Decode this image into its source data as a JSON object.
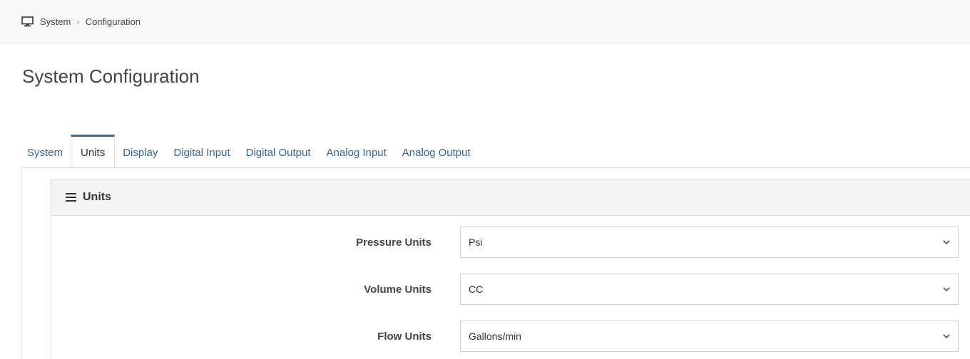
{
  "breadcrumb": {
    "icon": "monitor-icon",
    "items": [
      "System",
      "Configuration"
    ],
    "separator": "›"
  },
  "page": {
    "title": "System Configuration"
  },
  "tabs": [
    {
      "label": "System",
      "active": false
    },
    {
      "label": "Units",
      "active": true
    },
    {
      "label": "Display",
      "active": false
    },
    {
      "label": "Digital Input",
      "active": false
    },
    {
      "label": "Digital Output",
      "active": false
    },
    {
      "label": "Analog Input",
      "active": false
    },
    {
      "label": "Analog Output",
      "active": false
    }
  ],
  "panel": {
    "icon": "menu-icon",
    "title": "Units",
    "fields": [
      {
        "label": "Pressure Units",
        "value": "Psi"
      },
      {
        "label": "Volume Units",
        "value": "CC"
      },
      {
        "label": "Flow Units",
        "value": "Gallons/min"
      }
    ]
  },
  "colors": {
    "link": "#336699",
    "active_tab_border": "#3d6b8f"
  }
}
